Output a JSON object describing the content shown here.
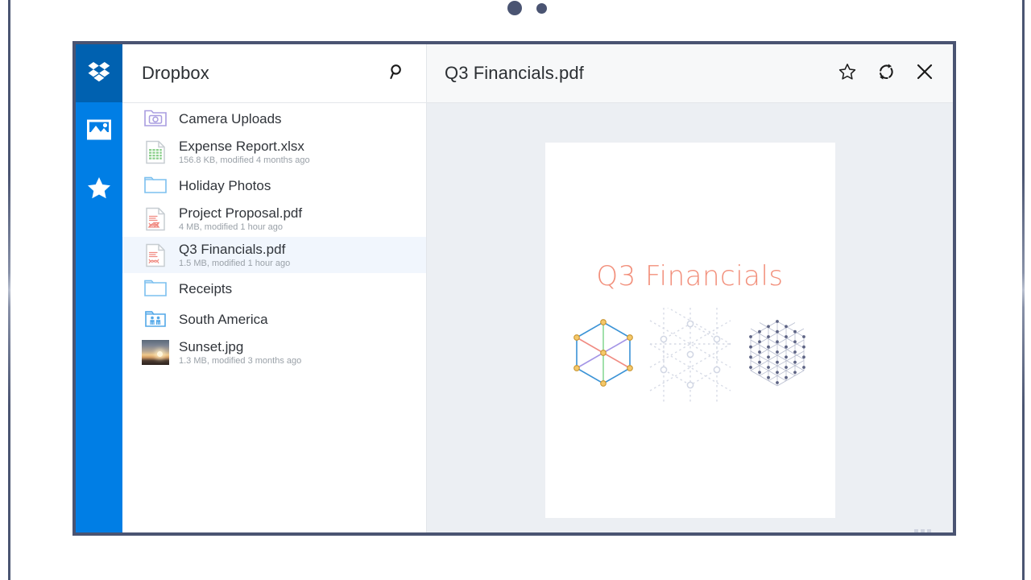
{
  "window": {
    "frame_color": "#4a5472",
    "accent_color": "#007ee5",
    "resize_grip_name": "resize-grip"
  },
  "pagination": {
    "dots": [
      {
        "name": "pagination-dot-1",
        "active": true
      },
      {
        "name": "pagination-dot-2",
        "active": false
      }
    ]
  },
  "iconbar": {
    "items": [
      {
        "icon": "dropbox-logo-icon",
        "label": "Dropbox",
        "active": true
      },
      {
        "icon": "photos-icon",
        "label": "Photos",
        "active": false
      },
      {
        "icon": "star-icon",
        "label": "Favorites",
        "active": false
      }
    ]
  },
  "filelist": {
    "header": {
      "title": "Dropbox",
      "search_icon": "search-icon"
    },
    "items": [
      {
        "name": "Camera Uploads",
        "meta": "",
        "icon": "camera-folder-icon",
        "selected": false
      },
      {
        "name": "Expense Report.xlsx",
        "meta": "156.8 KB, modified 4 months ago",
        "icon": "spreadsheet-file-icon",
        "selected": false
      },
      {
        "name": "Holiday Photos",
        "meta": "",
        "icon": "folder-icon",
        "selected": false
      },
      {
        "name": "Project Proposal.pdf",
        "meta": "4 MB, modified 1 hour ago",
        "icon": "pdf-file-icon",
        "selected": false
      },
      {
        "name": "Q3 Financials.pdf",
        "meta": "1.5 MB, modified 1 hour ago",
        "icon": "pdf-file-icon",
        "selected": true
      },
      {
        "name": "Receipts",
        "meta": "",
        "icon": "folder-icon",
        "selected": false
      },
      {
        "name": "South America",
        "meta": "",
        "icon": "shared-folder-icon",
        "selected": false
      },
      {
        "name": "Sunset.jpg",
        "meta": "1.3 MB, modified 3 months ago",
        "icon": "image-thumbnail",
        "selected": false
      }
    ]
  },
  "preview": {
    "title": "Q3 Financials.pdf",
    "actions": [
      {
        "name": "favorite-button",
        "icon": "star-outline-icon"
      },
      {
        "name": "sync-button",
        "icon": "sync-icon"
      },
      {
        "name": "close-button",
        "icon": "close-icon"
      }
    ],
    "document": {
      "heading": "Q3 Financials",
      "heading_color": "#f2907c",
      "figures": [
        {
          "name": "hexagon-graph-colored",
          "style": "solid-blue-edges-orange-nodes"
        },
        {
          "name": "hexagon-graph-faded",
          "style": "dotted-grey-extended"
        },
        {
          "name": "hexagon-lattice",
          "style": "triangular-lattice-dark-nodes"
        }
      ]
    }
  }
}
